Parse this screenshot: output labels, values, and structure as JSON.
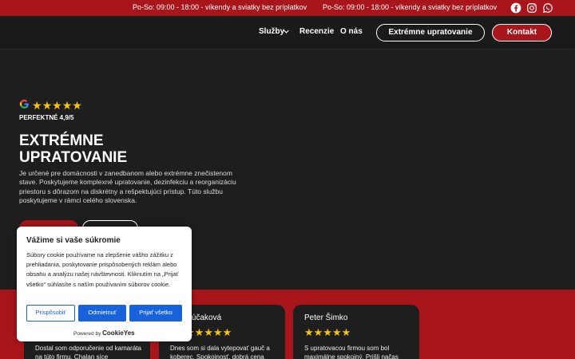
{
  "topbar": {
    "message_1": "Po-So: 09:00 - 18:00 - víkendy a sviatky bez príplatkov",
    "message_2": "Po-So: 09:00 - 18:00 - víkendy a sviatky bez príplatkov",
    "icons": [
      "facebook-icon",
      "instagram-icon",
      "whatsapp-icon"
    ]
  },
  "nav": {
    "items": [
      {
        "label": "Služby"
      },
      {
        "label": "Recenzie"
      },
      {
        "label": "O nás"
      }
    ],
    "cta_outline": "Extrémne upratovanie",
    "cta_red": "Kontakt"
  },
  "hero": {
    "rating_label": "PERFEKTNÉ 4,9/5",
    "rating_stars": 5,
    "title": "EXTRÉMNE UPRATOVANIE",
    "description": "Je určené pre domácnosti v zanedbanom alebo extrémne znečistenom stave. Poskytujeme komplexné upratovanie, dezinfekciu a reorganizáciu priestoru s dôrazom na diskrétny a rešpektujúci prístup. Túto službu poskytujeme v rámci celého slovenska."
  },
  "reviews": [
    {
      "name": "",
      "stars": 5,
      "text": "Dostal som odporučenie od kamaráta na túto firmu. Chalan síce"
    },
    {
      "name": "ľúčaková",
      "stars": 5,
      "text": "Dnes som si dala vytepovať gauč a koberec. Spokojnosť, dobrá cena"
    },
    {
      "name": "Peter Šimko",
      "stars": 5,
      "text": "S upratovacou firmou som bol maximálne spokojný. Prišli načas"
    }
  ],
  "cookie": {
    "title": "Vážime si vaše súkromie",
    "text": "Súbory cookie používame na zlepšenie vášho zážitku z prehliadania, poskytovanie prispôsobených reklám alebo obsahu a analýzu našej návštevnosti. Kliknutím na „Prijať všetko“ súhlasíte s naším používaním súborov cookie.",
    "btn_customize": "Prispôsobiť",
    "btn_reject": "Odmietnuť",
    "btn_accept": "Prijať všetko",
    "powered_prefix": "Powered by",
    "powered_brand": "CookieYes"
  },
  "colors": {
    "brand_red": "#a8161b",
    "dark_bg": "#1e1e1e",
    "star": "#f6c40d",
    "cookie_blue": "#1863dc"
  }
}
